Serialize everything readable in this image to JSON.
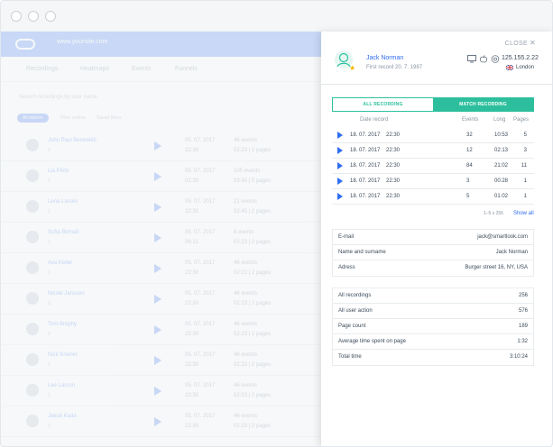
{
  "background_app": {
    "site": "www.yoursite.com",
    "tabs": [
      "Recordings",
      "Heatmaps",
      "Events",
      "Funnels"
    ],
    "search_placeholder": "Search recordings by user name",
    "chips": [
      "All visitors",
      "Filter visitors",
      "Saved filters"
    ],
    "rows": [
      {
        "name": "John Paul Benedetti",
        "sub": "2",
        "date": "05. 07. 2017",
        "time": "22:30",
        "events": "46 events",
        "pages": "02:23 | 2 pages"
      },
      {
        "name": "Lia Pinto",
        "sub": "2",
        "date": "05. 07. 2017",
        "time": "02:30",
        "events": "105 events",
        "pages": "03:45 | 5 pages"
      },
      {
        "name": "Lena Larsen",
        "sub": "1",
        "date": "05. 07. 2017",
        "time": "22:30",
        "events": "21 events",
        "pages": "02:45 | 2 pages"
      },
      {
        "name": "Sofia Bernall",
        "sub": "1",
        "date": "05. 07. 2017",
        "time": "06:21",
        "events": "8 events",
        "pages": "02:23 | 2 pages"
      },
      {
        "name": "Ava Keller",
        "sub": "2",
        "date": "05. 07. 2017",
        "time": "22:30",
        "events": "46 events",
        "pages": "02:23 | 2 pages"
      },
      {
        "name": "Nicole Janssen",
        "sub": "3",
        "date": "05. 07. 2017",
        "time": "22:30",
        "events": "46 events",
        "pages": "02:23 | 2 pages"
      },
      {
        "name": "Tom Brophy",
        "sub": "2",
        "date": "05. 07. 2017",
        "time": "22:30",
        "events": "46 events",
        "pages": "02:23 | 2 pages"
      },
      {
        "name": "Nick Kramer",
        "sub": "2",
        "date": "05. 07. 2017",
        "time": "22:30",
        "events": "46 events",
        "pages": "02:23 | 2 pages"
      },
      {
        "name": "Lee Larson",
        "sub": "1",
        "date": "05. 07. 2017",
        "time": "22:30",
        "events": "46 events",
        "pages": "02:23 | 2 pages"
      },
      {
        "name": "Jakub Kada",
        "sub": "2",
        "date": "05. 07. 2017",
        "time": "22:30",
        "events": "46 events",
        "pages": "02:23 | 2 pages"
      }
    ]
  },
  "panel": {
    "close_label": "CLOSE",
    "close_glyph": "✕",
    "user": {
      "name": "Jack Norman",
      "first_record": "First record 20. 7. 1987"
    },
    "system": {
      "ip": "125.155.2.22",
      "city": "London",
      "icons": [
        "monitor-icon",
        "apple-icon",
        "chrome-icon"
      ]
    },
    "toggle": {
      "all": "ALL RECORDING",
      "match": "MATCH RECORDING"
    },
    "columns": {
      "date": "Date record",
      "events": "Events",
      "long": "Long",
      "pages": "Pages"
    },
    "recordings": [
      {
        "date": "18. 07. 2017",
        "time": "22:30",
        "events": "32",
        "long": "10:53",
        "pages": "5"
      },
      {
        "date": "18. 07. 2017",
        "time": "22:30",
        "events": "12",
        "long": "02:13",
        "pages": "3"
      },
      {
        "date": "18. 07. 2017",
        "time": "22:30",
        "events": "84",
        "long": "21:02",
        "pages": "11"
      },
      {
        "date": "18. 07. 2017",
        "time": "22:30",
        "events": "3",
        "long": "00:28",
        "pages": "1"
      },
      {
        "date": "18. 07. 2017",
        "time": "22:30",
        "events": "5",
        "long": "01:02",
        "pages": "1"
      }
    ],
    "pager": "1–5 z 256",
    "show_all": "Show all",
    "contact": [
      {
        "label": "E-mail",
        "value": "jack@smartlook.com"
      },
      {
        "label": "Name and surname",
        "value": "Jack Norman"
      },
      {
        "label": "Adress",
        "value": "Burger street 16, NY, USA"
      }
    ],
    "stats": [
      {
        "label": "All recordings",
        "value": "256"
      },
      {
        "label": "All user action",
        "value": "576"
      },
      {
        "label": "Page count",
        "value": "189"
      },
      {
        "label": "Average time spent on page",
        "value": "1:32"
      },
      {
        "label": "Total time",
        "value": "3:10:24"
      }
    ]
  },
  "colors": {
    "accent": "#2dbf9d",
    "link": "#2f6df1",
    "star": "#f5b400"
  }
}
